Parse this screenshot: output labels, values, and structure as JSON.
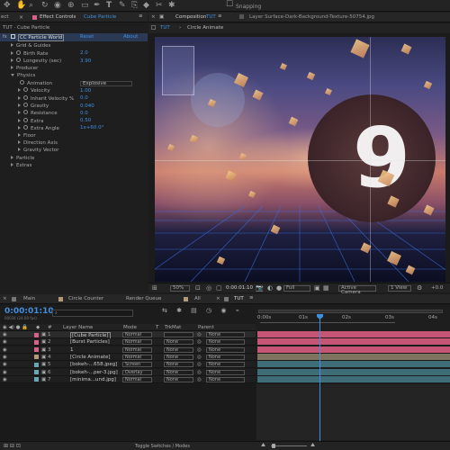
{
  "top_toolbar": {
    "snapping": "Snapping"
  },
  "effect_controls": {
    "close": "ect",
    "tab_label": "Effect Controls",
    "tab_layer": "Cube Particle",
    "layer_path": "TUT · Cube Particle",
    "effect_name": "CC Particle World",
    "reset": "Reset",
    "about": "About",
    "rows": [
      {
        "label": "Grid & Guides",
        "value": ""
      },
      {
        "label": "Birth Rate",
        "value": "2.0"
      },
      {
        "label": "Longevity (sec)",
        "value": "3.90"
      },
      {
        "label": "Producer",
        "value": ""
      },
      {
        "label": "Physics",
        "value": ""
      },
      {
        "label": "Animation",
        "value": "Explosive"
      },
      {
        "label": "Velocity",
        "value": "1.00"
      },
      {
        "label": "Inherit Velocity %",
        "value": "0.0"
      },
      {
        "label": "Gravity",
        "value": "0.040"
      },
      {
        "label": "Resistance",
        "value": "0.0"
      },
      {
        "label": "Extra",
        "value": "0.50"
      },
      {
        "label": "Extra Angle",
        "value": "1x+60.0°"
      },
      {
        "label": "Floor",
        "value": ""
      },
      {
        "label": "Direction Axis",
        "value": ""
      },
      {
        "label": "Gravity Vector",
        "value": ""
      },
      {
        "label": "Particle",
        "value": ""
      },
      {
        "label": "Extras",
        "value": ""
      }
    ]
  },
  "composition": {
    "tab_label": "Composition",
    "tab_comp": "TUT",
    "menu_icon": "≡",
    "footage_label": "Layer Surface-Dark-Background-Texture-50754.jpg",
    "subtabs": [
      "TUT",
      "Circle Animate"
    ],
    "big_text": "9",
    "footer": {
      "zoom": "50%",
      "time": "0:00:01:10",
      "quality": "Full",
      "camera": "Active Camera",
      "views": "1 View",
      "offset": "+0.0"
    }
  },
  "timeline": {
    "tabs": [
      "Main",
      "Circle Counter",
      "Render Queue",
      "All",
      "TUT"
    ],
    "timecode": "0:00:01:10",
    "frame_info": "00034 (24.00 fps)",
    "search_placeholder": "",
    "col_headers": {
      "num": "#",
      "layer_name": "Layer Name",
      "mode": "Mode",
      "t": "T",
      "trkmat": "TrkMat",
      "parent": "Parent"
    },
    "ruler": [
      "0:00s",
      "01s",
      "02s",
      "03s",
      "04s"
    ],
    "layers": [
      {
        "num": "1",
        "name": "[Cube Particle]",
        "mode": "Normal",
        "trkmat": "",
        "parent": "None",
        "color": "#d8618a",
        "bar_color": "#c65576"
      },
      {
        "num": "2",
        "name": "[Burst Particles]",
        "mode": "Normal",
        "trkmat": "None",
        "parent": "None",
        "color": "#d8618a",
        "bar_color": "#c65576"
      },
      {
        "num": "3",
        "name": "1",
        "mode": "Normal",
        "trkmat": "None",
        "parent": "None",
        "color": "#d8618a",
        "bar_color": "#c65576"
      },
      {
        "num": "4",
        "name": "[Circle Animate]",
        "mode": "Normal",
        "trkmat": "None",
        "parent": "None",
        "color": "#b39b7a",
        "bar_color": "#7d735f"
      },
      {
        "num": "5",
        "name": "[bokeh-...658.jpeg]",
        "mode": "Screen",
        "trkmat": "None",
        "parent": "None",
        "color": "#6aa6b6",
        "bar_color": "#3f6d77"
      },
      {
        "num": "6",
        "name": "[bokeh-...per-3.jpg]",
        "mode": "Overlay",
        "trkmat": "None",
        "parent": "None",
        "color": "#6aa6b6",
        "bar_color": "#3f6d77"
      },
      {
        "num": "7",
        "name": "[minima...und.jpg]",
        "mode": "Normal",
        "trkmat": "None",
        "parent": "None",
        "color": "#6aa6b6",
        "bar_color": "#3f6d77"
      }
    ],
    "toggle_label": "Toggle Switches / Modes"
  },
  "colors": {
    "accent": "#3f8fe0",
    "panel": "#1d1d1d",
    "layer_pink": "#c65576"
  }
}
